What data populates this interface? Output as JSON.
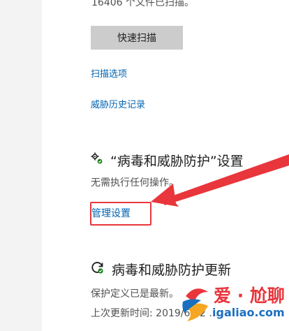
{
  "threat_history_section": {
    "scan_status": "16406 个文件已扫描。",
    "quick_scan_label": "快速扫描",
    "scan_options_link": "扫描选项",
    "threat_history_link": "威胁历史记录"
  },
  "protection_settings": {
    "title": "“病毒和威胁防护”设置",
    "status": "无需执行任何操作。",
    "manage_link": "管理设置",
    "icon": "gears-icon"
  },
  "protection_updates": {
    "title": "病毒和威胁防护更新",
    "status": "保护定义已是最新。",
    "last_update": "上次更新时间: 2019/6/12 ...",
    "icon": "refresh-icon"
  },
  "annotation": {
    "highlight_color": "#e8363c",
    "arrow_color": "#e8363c"
  },
  "watermark": {
    "brand": "爱 · 尬聊",
    "domain": "igaliao.com"
  },
  "colors": {
    "link": "#0063b1",
    "button_bg": "#cccccc",
    "text": "#1f1f1f",
    "secondary_text": "#505050"
  }
}
